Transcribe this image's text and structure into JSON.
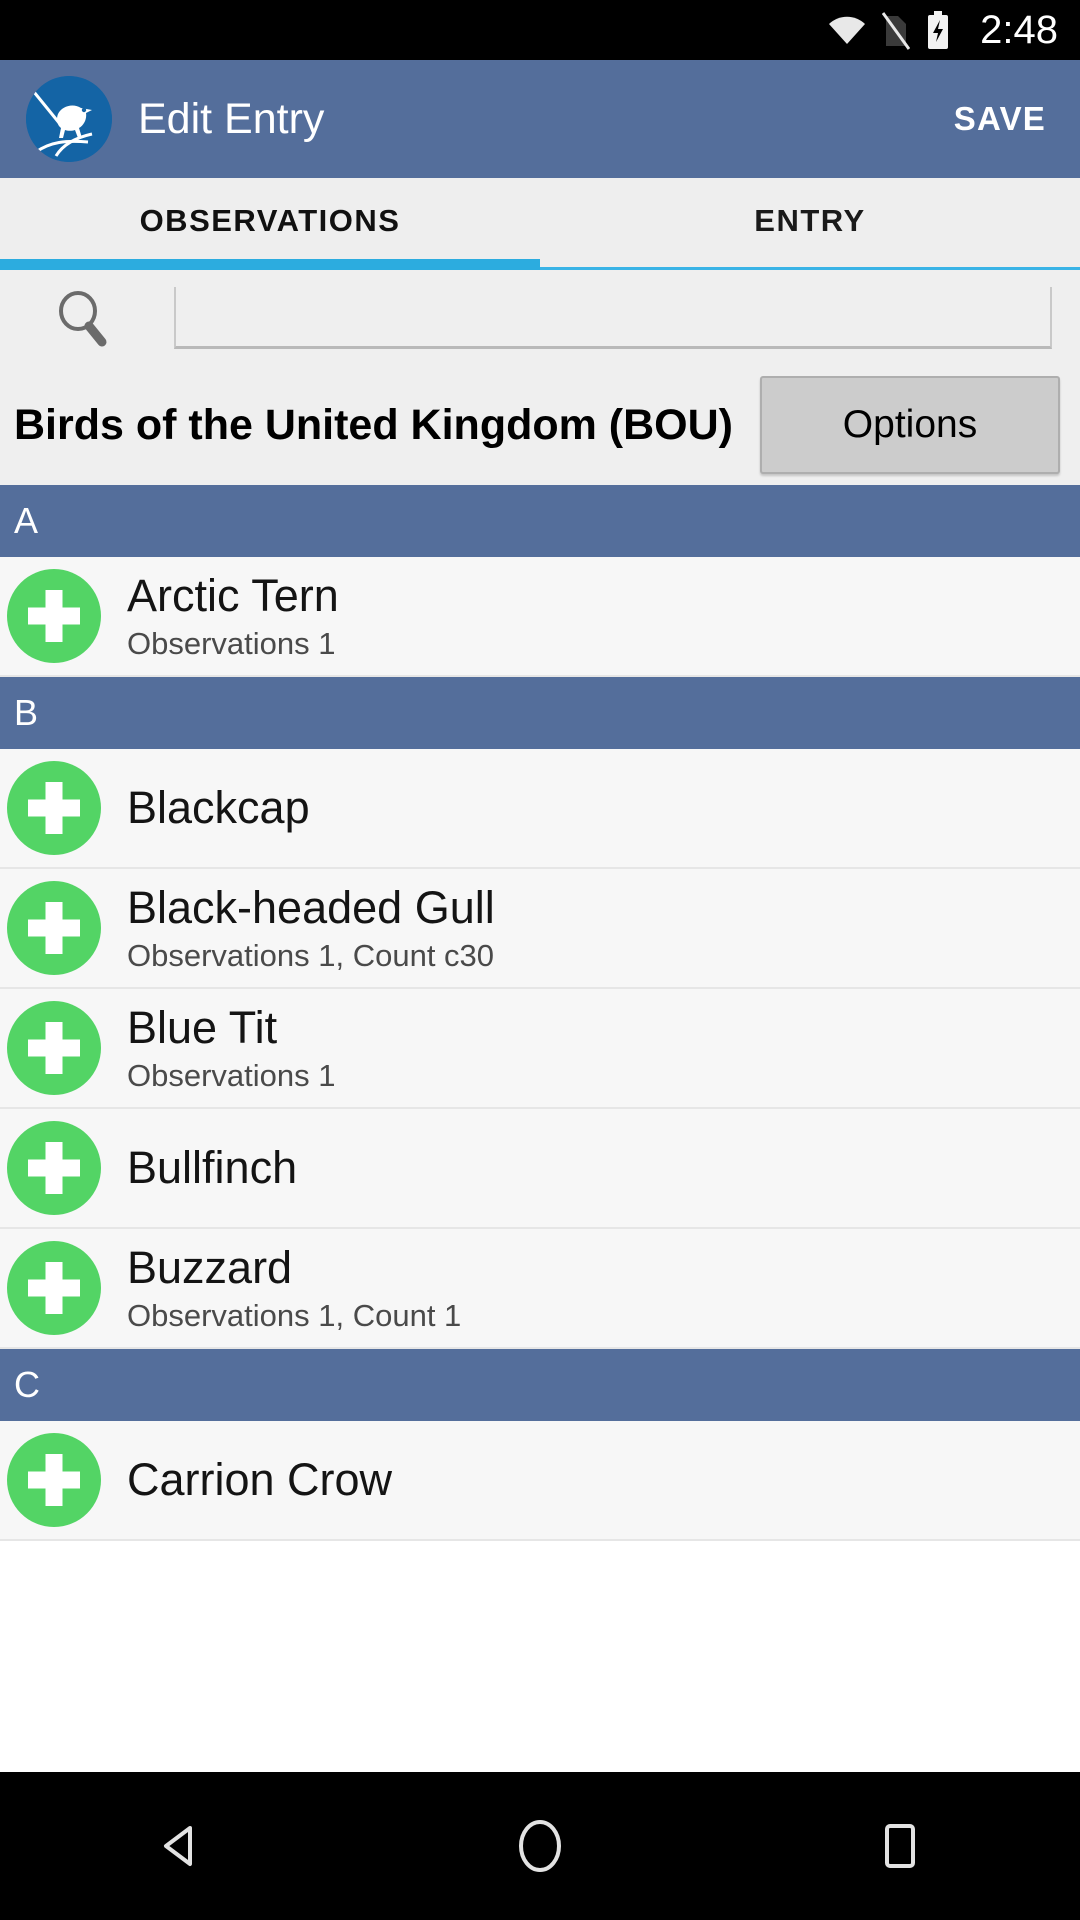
{
  "status_bar": {
    "time": "2:48",
    "icons": [
      "wifi-icon",
      "no-sim-icon",
      "battery-charging-icon"
    ]
  },
  "app_bar": {
    "logo_icon": "bird-logo-icon",
    "title": "Edit Entry",
    "save_label": "SAVE",
    "background_color": "#546e9b"
  },
  "tabs": {
    "items": [
      {
        "label": "OBSERVATIONS",
        "active": true
      },
      {
        "label": "ENTRY",
        "active": false
      }
    ],
    "indicator_color": "#2cacdf"
  },
  "search": {
    "icon": "search-icon",
    "value": "",
    "placeholder": ""
  },
  "checklist": {
    "title": "Birds of the United Kingdom (BOU)",
    "options_label": "Options"
  },
  "list": {
    "add_icon": "plus-circle-icon",
    "sections": [
      {
        "letter": "A",
        "rows": [
          {
            "name": "Arctic Tern",
            "detail": "Observations 1"
          }
        ]
      },
      {
        "letter": "B",
        "rows": [
          {
            "name": "Blackcap",
            "detail": ""
          },
          {
            "name": "Black-headed Gull",
            "detail": "Observations 1, Count c30"
          },
          {
            "name": "Blue Tit",
            "detail": "Observations 1"
          },
          {
            "name": "Bullfinch",
            "detail": ""
          },
          {
            "name": "Buzzard",
            "detail": "Observations 1, Count 1"
          }
        ]
      },
      {
        "letter": "C",
        "rows": [
          {
            "name": "Carrion Crow",
            "detail": ""
          }
        ]
      }
    ]
  },
  "nav_bar": {
    "back_icon": "back-triangle-icon",
    "home_icon": "home-circle-icon",
    "recents_icon": "recents-square-icon"
  },
  "colors": {
    "primary": "#546e9b",
    "accent": "#2cacdf",
    "add_green": "#53d465",
    "surface": "#efefef"
  }
}
